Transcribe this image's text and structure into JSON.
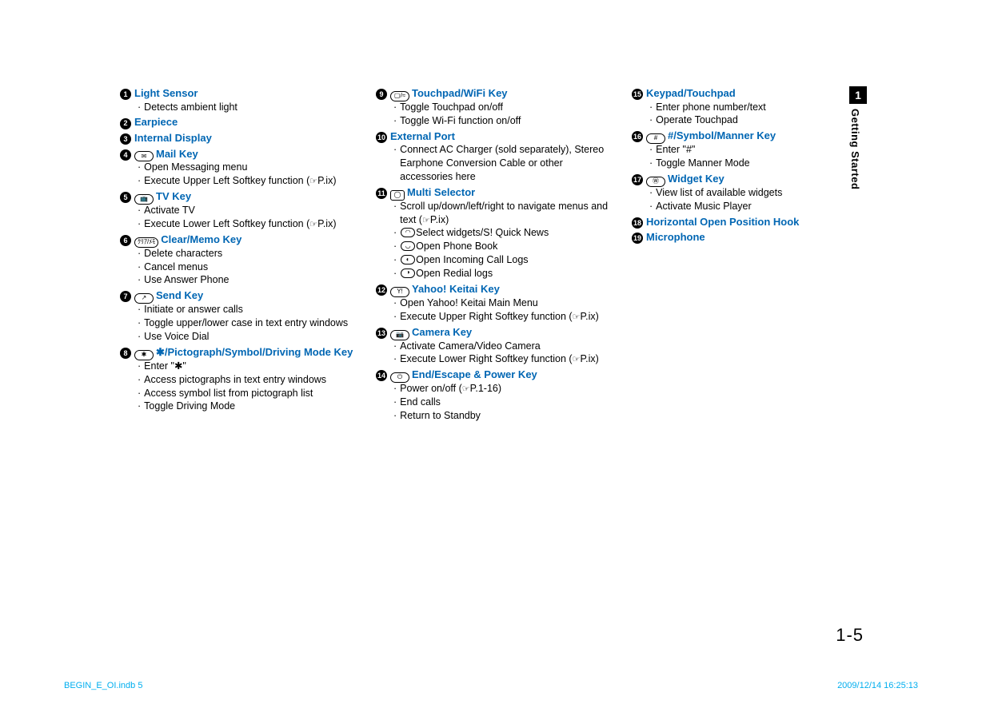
{
  "sideTab": {
    "num": "1",
    "label": "Getting Started"
  },
  "pageNum": "1-5",
  "footer": {
    "left": "BEGIN_E_OI.indb   5",
    "right": "2009/12/14   16:25:13"
  },
  "columns": [
    [
      {
        "n": "1",
        "title": "Light Sensor",
        "subs": [
          "Detects ambient light"
        ]
      },
      {
        "n": "2",
        "title": "Earpiece"
      },
      {
        "n": "3",
        "title": "Internal Display"
      },
      {
        "n": "4",
        "icon": "✉",
        "title": "Mail Key",
        "subs": [
          "Open Messaging menu",
          "Execute Upper Left Softkey function (☞P.ix)"
        ]
      },
      {
        "n": "5",
        "icon": "📺",
        "title": "TV Key",
        "subs": [
          "Activate TV",
          "Execute Lower Left Softkey function (☞P.ix)"
        ]
      },
      {
        "n": "6",
        "icon": "ｸﾘｱ/ﾒﾓ",
        "title": "Clear/Memo Key",
        "subs": [
          "Delete characters",
          "Cancel menus",
          "Use Answer Phone"
        ]
      },
      {
        "n": "7",
        "icon": "↗",
        "title": "Send Key",
        "subs": [
          "Initiate or answer calls",
          "Toggle upper/lower case in text entry windows",
          "Use Voice Dial"
        ]
      },
      {
        "n": "8",
        "icon": "✱",
        "title": "✱/Pictograph/Symbol/Driving Mode Key",
        "subs": [
          "Enter \"✱\"",
          "Access pictographs in text entry windows",
          "Access symbol list from pictograph list",
          "Toggle Driving Mode"
        ]
      }
    ],
    [
      {
        "n": "9",
        "icon": "▢/≈",
        "title": "Touchpad/WiFi Key",
        "subs": [
          "Toggle Touchpad on/off",
          "Toggle Wi-Fi function on/off"
        ]
      },
      {
        "n": "10",
        "title": "External Port",
        "subs": [
          "Connect AC Charger (sold separately), Stereo Earphone Conversion Cable or other accessories here"
        ]
      },
      {
        "n": "11",
        "icon": "◯",
        "iconSquare": true,
        "title": "Multi Selector",
        "subs": [
          "Scroll up/down/left/right to navigate menus and text (☞P.ix)"
        ],
        "iconSubs": [
          {
            "i": "◠",
            "t": "Select widgets/S! Quick News"
          },
          {
            "i": "◡",
            "t": "Open Phone Book"
          },
          {
            "i": "◐",
            "t": "Open Incoming Call Logs"
          },
          {
            "i": "◑",
            "t": "Open Redial logs"
          }
        ]
      },
      {
        "n": "12",
        "icon": "Y!",
        "title": "Yahoo! Keitai Key",
        "subs": [
          "Open Yahoo! Keitai Main Menu",
          "Execute Upper Right Softkey function (☞P.ix)"
        ]
      },
      {
        "n": "13",
        "icon": "📷",
        "title": "Camera Key",
        "subs": [
          "Activate Camera/Video Camera",
          "Execute Lower Right Softkey function (☞P.ix)"
        ]
      },
      {
        "n": "14",
        "icon": "⏻",
        "title": "End/Escape & Power Key",
        "subs": [
          "Power on/off (☞P.1-16)",
          "End calls",
          "Return to Standby"
        ]
      }
    ],
    [
      {
        "n": "15",
        "title": "Keypad/Touchpad",
        "subs": [
          "Enter phone number/text",
          "Operate Touchpad"
        ]
      },
      {
        "n": "16",
        "icon": "#",
        "title": "#/Symbol/Manner Key",
        "subs": [
          "Enter \"#\"",
          "Toggle Manner Mode"
        ]
      },
      {
        "n": "17",
        "icon": "Ⓦ",
        "title": "Widget Key",
        "subs": [
          "View list of available widgets",
          "Activate Music Player"
        ]
      },
      {
        "n": "18",
        "title": "Horizontal Open Position Hook"
      },
      {
        "n": "19",
        "title": "Microphone"
      }
    ]
  ]
}
